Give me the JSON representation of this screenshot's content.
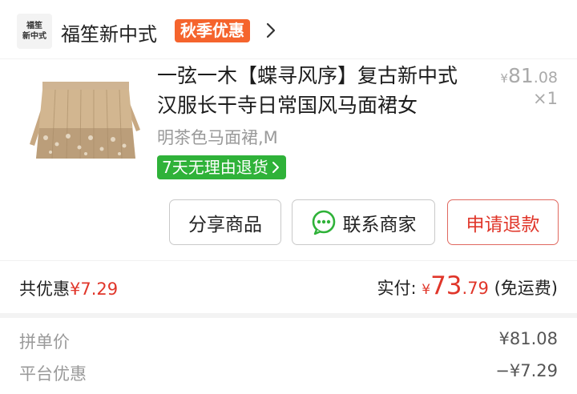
{
  "store": {
    "logo_line1": "福笙",
    "logo_line2": "新中式",
    "name": "福笙新中式",
    "promo_badge": "秋季优惠"
  },
  "product": {
    "title": "一弦一木【蝶寻风序】复古新中式汉服长干寺日常国风马面裙女",
    "variant": "明茶色马面裙,M",
    "price_symbol": "¥",
    "price_int": "81",
    "price_dec": ".08",
    "quantity": "×1",
    "return_badge": "7天无理由退货"
  },
  "actions": {
    "share": "分享商品",
    "contact": "联系商家",
    "refund": "申请退款"
  },
  "summary": {
    "discount_label": "共优惠",
    "discount_value": "¥7.29",
    "paid_label": "实付: ",
    "paid_symbol": "¥",
    "paid_int": "73",
    "paid_dec": ".79",
    "shipping_note": "(免运费)"
  },
  "details": [
    {
      "label": "拼单价",
      "value": "¥81.08"
    },
    {
      "label": "平台优惠",
      "value": "−¥7.29"
    }
  ],
  "colors": {
    "promo": "#f5642d",
    "return_badge": "#2fb239",
    "accent_red": "#e0362a",
    "chat_icon": "#2fb239"
  }
}
